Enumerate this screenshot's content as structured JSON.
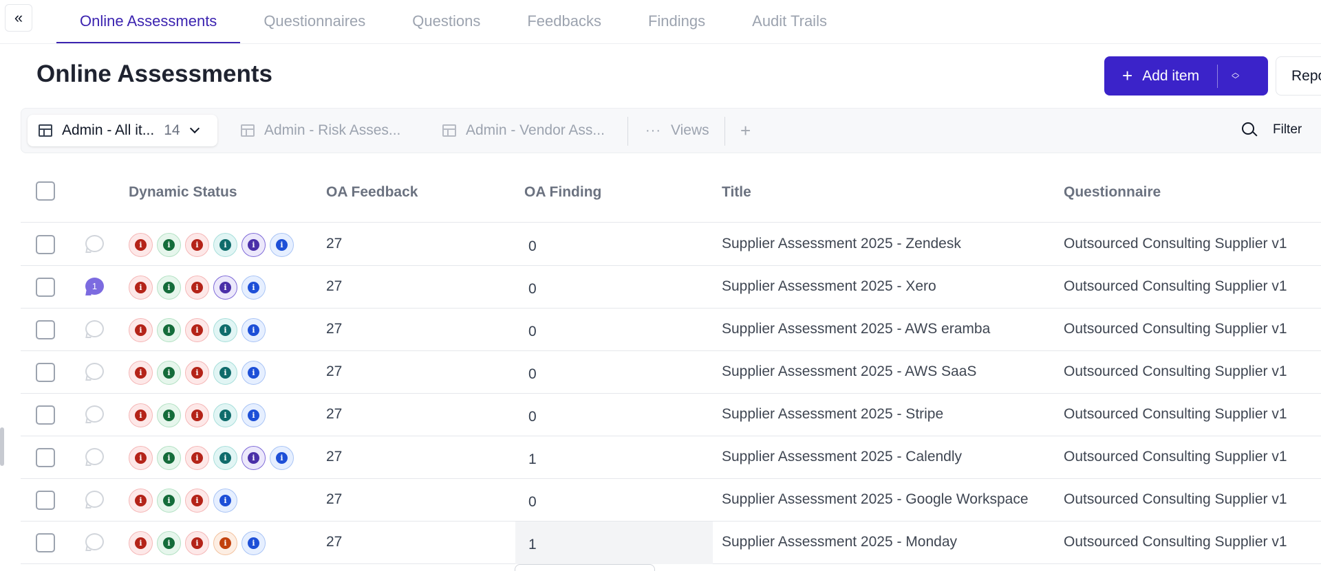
{
  "nav": {
    "collapse_icon": "double-chevron-left-icon",
    "collapse_glyph": "«",
    "tabs": [
      {
        "label": "Online Assessments",
        "active": true
      },
      {
        "label": "Questionnaires"
      },
      {
        "label": "Questions"
      },
      {
        "label": "Feedbacks"
      },
      {
        "label": "Findings"
      },
      {
        "label": "Audit Trails"
      }
    ]
  },
  "page": {
    "title": "Online Assessments"
  },
  "toolbar": {
    "add_item_label": "Add item",
    "add_item_icon": "plus-icon",
    "report_label": "Repo",
    "accent_color": "#3b23c9"
  },
  "views": {
    "active": {
      "label": "Admin - All it...",
      "count": "14"
    },
    "tabs": [
      {
        "label": "Admin - Risk Asses..."
      },
      {
        "label": "Admin - Vendor Ass..."
      }
    ],
    "more_label": "Views",
    "more_glyph": "···",
    "add_glyph": "+",
    "filter_label": "Filter"
  },
  "table": {
    "columns": [
      "Dynamic Status",
      "OA Feedback",
      "OA Finding",
      "Title",
      "Questionnaire"
    ],
    "rows": [
      {
        "comments": "",
        "status": [
          "red",
          "green",
          "red",
          "teal",
          "purple",
          "blue"
        ],
        "feedback": "27",
        "finding": "0",
        "title": "Supplier Assessment 2025 - Zendesk",
        "questionnaire": "Outsourced Consulting Supplier v1"
      },
      {
        "comments": "1",
        "status": [
          "red",
          "green",
          "red",
          "purple",
          "blue"
        ],
        "feedback": "27",
        "finding": "0",
        "title": "Supplier Assessment 2025 - Xero",
        "questionnaire": "Outsourced Consulting Supplier v1"
      },
      {
        "comments": "",
        "status": [
          "red",
          "green",
          "red",
          "teal",
          "blue"
        ],
        "feedback": "27",
        "finding": "0",
        "title": "Supplier Assessment 2025 - AWS eramba",
        "questionnaire": "Outsourced Consulting Supplier v1"
      },
      {
        "comments": "",
        "status": [
          "red",
          "green",
          "red",
          "teal",
          "blue"
        ],
        "feedback": "27",
        "finding": "0",
        "title": "Supplier Assessment 2025 - AWS SaaS",
        "questionnaire": "Outsourced Consulting Supplier v1"
      },
      {
        "comments": "",
        "status": [
          "red",
          "green",
          "red",
          "teal",
          "blue"
        ],
        "feedback": "27",
        "finding": "0",
        "title": "Supplier Assessment 2025 - Stripe",
        "questionnaire": "Outsourced Consulting Supplier v1"
      },
      {
        "comments": "",
        "status": [
          "red",
          "green",
          "red",
          "teal",
          "purple",
          "blue"
        ],
        "feedback": "27",
        "finding": "1",
        "title": "Supplier Assessment 2025 - Calendly",
        "questionnaire": "Outsourced Consulting Supplier v1"
      },
      {
        "comments": "",
        "status": [
          "red",
          "green",
          "red",
          "blue"
        ],
        "feedback": "27",
        "finding": "0",
        "title": "Supplier Assessment 2025 - Google Workspace",
        "questionnaire": "Outsourced Consulting Supplier v1"
      },
      {
        "comments": "",
        "status": [
          "red",
          "green",
          "red",
          "orange",
          "blue"
        ],
        "feedback": "27",
        "finding": "1",
        "title": "Supplier Assessment 2025 - Monday",
        "questionnaire": "Outsourced Consulting Supplier v1",
        "highlight_finding": true
      }
    ]
  }
}
